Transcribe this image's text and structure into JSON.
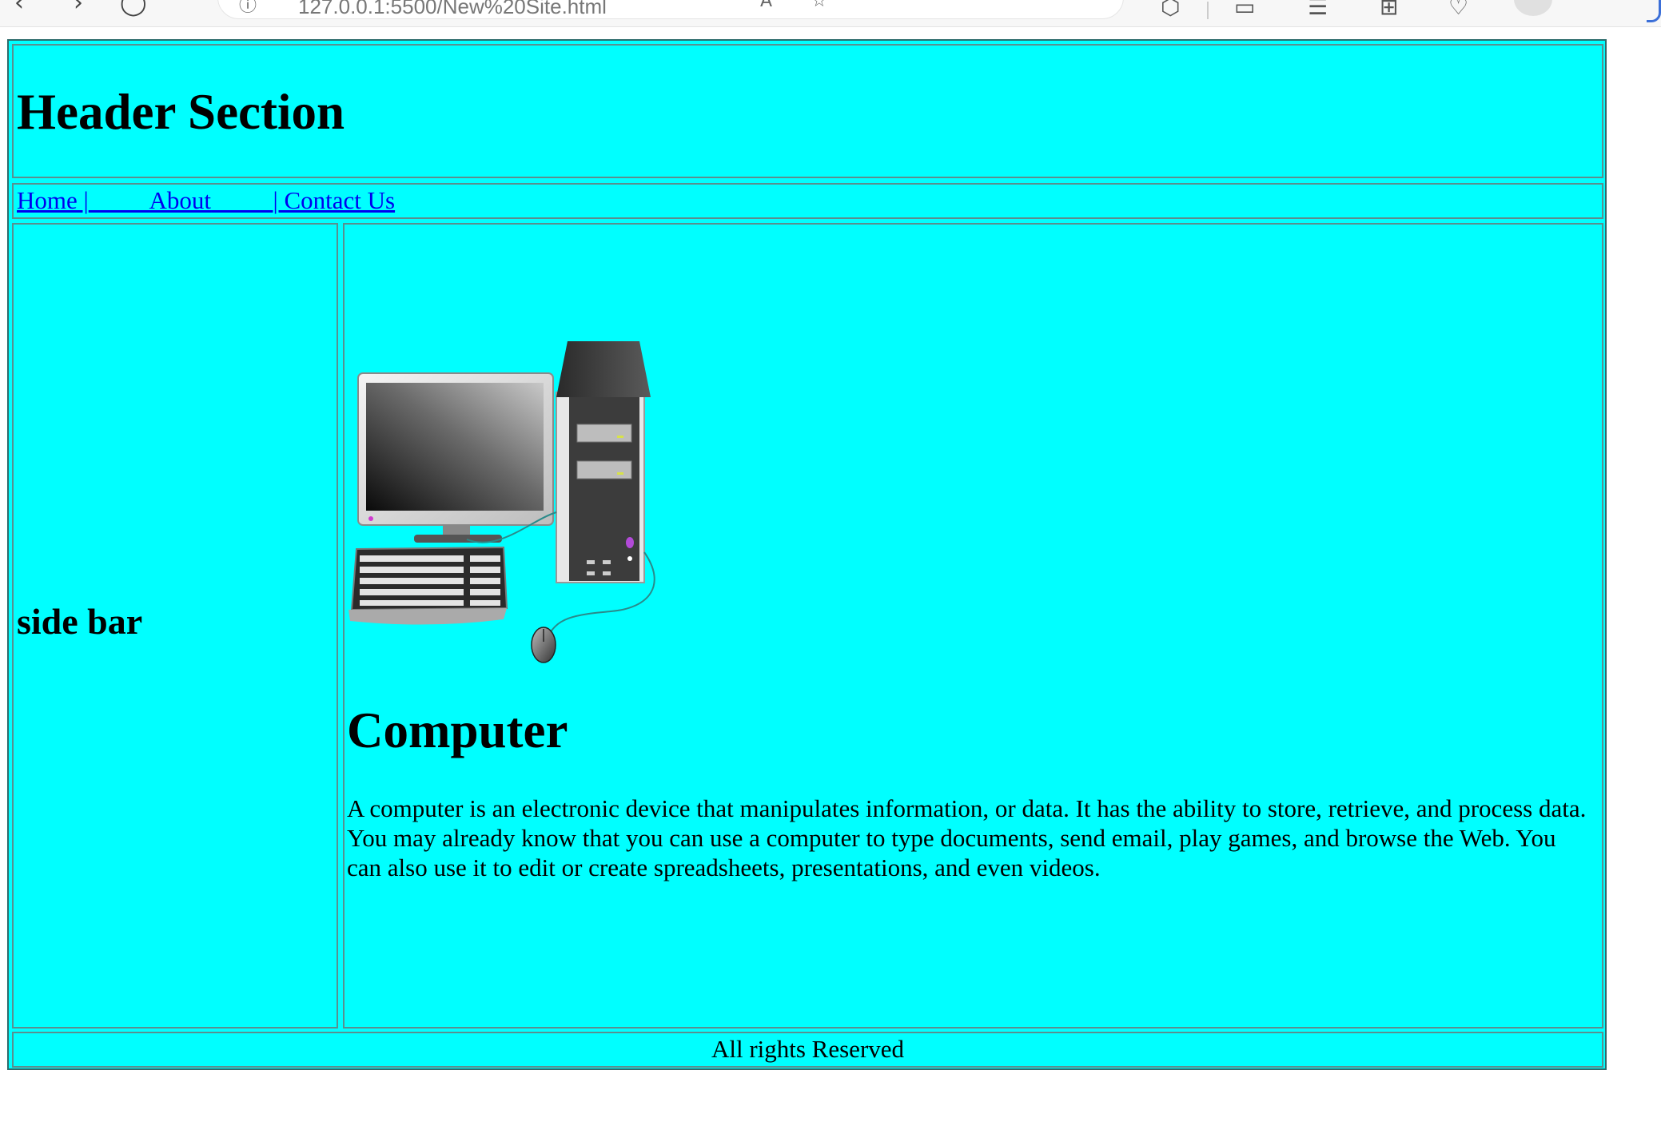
{
  "browser": {
    "url": "127.0.0.1:5500/New%20Site.html",
    "icons": [
      "back-icon",
      "forward-icon",
      "refresh-icon",
      "site-info-icon",
      "read-aloud-icon",
      "favorite-star-icon",
      "extensions-icon",
      "split-screen-icon",
      "favorites-icon",
      "collections-icon",
      "browser-essentials-icon",
      "profile-icon"
    ]
  },
  "header": {
    "title": "Header Section"
  },
  "nav": {
    "home": "Home |",
    "gap1": "          ",
    "about": "About",
    "gap2": "          ",
    "contact": "| Contact Us"
  },
  "sidebar": {
    "text": "side bar"
  },
  "main": {
    "image_alt": "Desktop computer with monitor, tower, keyboard and mouse",
    "title": "Computer",
    "paragraph": "A computer is an electronic device that manipulates information, or data. It has the ability to store, retrieve, and process data. You may already know that you can use a computer to type documents, send email, play games, and browse the Web. You can also use it to edit or create spreadsheets, presentations, and even videos."
  },
  "footer": {
    "text": "All rights Reserved"
  },
  "colors": {
    "page_bg": "#00ffff",
    "link": "#0000ee",
    "border": "#5a8f8f"
  }
}
